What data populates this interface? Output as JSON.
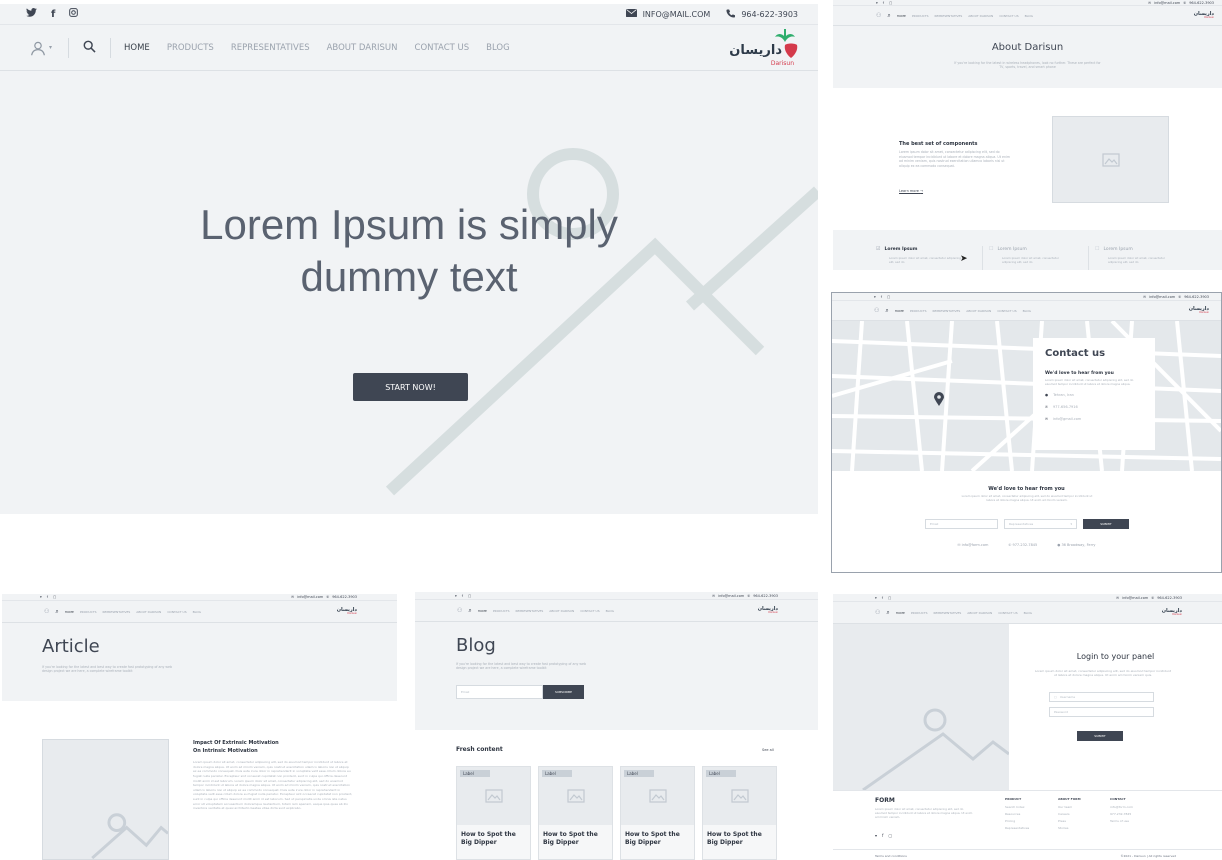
{
  "common": {
    "email": "INFO@MAIL.COM",
    "email_small": "info@mail.com",
    "phone": "964-622-3903",
    "nav": [
      "HOME",
      "PRODUCTS",
      "REPRESENTATIVES",
      "ABOUT DARISUN",
      "CONTACT US",
      "BLOG"
    ],
    "logo_fa": "داریسان",
    "logo_en": "Darisun"
  },
  "home": {
    "hero_title_line1": "Lorem Ipsum is simply",
    "hero_title_line2": "dummy text",
    "cta": "START NOW!"
  },
  "about": {
    "title": "About Darisun",
    "subtitle": "If you're looking for the latest in wireless headphones, look no further. These are perfect for TV, sports, travel, and smart phone",
    "section_title": "The best set of components",
    "section_text": "Lorem ipsum dolor sit amet, consectetur adipiscing elit, sed do eiusmod tempor incididunt ut labore et dolore magna aliqua. Ut enim ad minim veniam, quis nostrud exercitation ullamco laboris nisi ut aliquip ex ea commodo consequat.",
    "learn_more": "Learn more",
    "features": [
      {
        "title": "Lorem Ipsum",
        "text": "Lorem ipsum dolor sit amet, consectetur adipiscing elit, sed do"
      },
      {
        "title": "Lorem Ipsum",
        "text": "Lorem ipsum dolor sit amet, consectetur adipiscing elit, sed do"
      },
      {
        "title": "Lorem Ipsum",
        "text": "Lorem ipsum dolor sit amet, consectetur adipiscing elit, sed do"
      }
    ]
  },
  "contact": {
    "card_title": "Contact us",
    "card_subtitle": "We'd love to hear from you",
    "card_text": "Lorem ipsum dolor sit amet, consectetur adipiscing elit, sed do eiusmod tempor incididunt ut labore et dolore magna aliqua.",
    "address": "Tehran, Iran",
    "phone": "977-656-7916",
    "email": "info@gmail.com",
    "form_title": "We'd love to hear from you",
    "form_text": "Lorem ipsum dolor sit amet, consectetur adipiscing elit, sed do eiusmod tempor incididunt ut labore et dolore magna aliqua. Ut enim ad minim veniam.",
    "email_placeholder": "Email",
    "select_placeholder": "Representatives",
    "submit": "SUBMIT",
    "footer_email": "info@form.com",
    "footer_phone": "977-232-7845",
    "footer_address": "36 Broadway, Ferry"
  },
  "article": {
    "title": "Article",
    "subtitle": "If you're looking for the latest and best way to create fast prototyping of any web design project we are here, a complete wireframe toolkit",
    "heading_line1": "Impact Of Extrinsic Motivation",
    "heading_line2": "On Intrinsic Motivation",
    "body": "Lorem ipsum dolor sit amet, consectetur adipiscing elit, sed do eiusmod tempor incididunt ut labore et dolore magna aliqua. Ut enim ad minim veniam, quis nostrud exercitation ullamco laboris nisi ut aliquip ex ea commodo consequat. Duis aute irure dolor in reprehenderit in voluptate velit esse cillum dolore eu fugiat nulla pariatur. Excepteur sint occaecat cupidatat non proident, sunt in culpa qui officia deserunt mollit anim id est laborum. Lorem ipsum dolor sit amet, consectetur adipiscing elit, sed do eiusmod tempor incididunt ut labore et dolore magna aliqua. Ut enim ad minim veniam, quis nostrud exercitation ullamco laboris nisi ut aliquip ex ea commodo consequat. Duis aute irure dolor in reprehenderit in voluptate velit esse cillum dolore eu fugiat nulla pariatur. Excepteur sint occaecat cupidatat non proident, sunt in culpa qui officia deserunt mollit anim id est laborum. Sed ut perspiciatis unde omnis iste natus error sit voluptatem accusantium doloremque laudantium, totam rem aperiam, eaque ipsa quae ab illo inventore veritatis et quasi architecto beatae vitae dicta sunt explicabo."
  },
  "blog": {
    "title": "Blog",
    "subtitle": "If you're looking for the latest and best way to create fast prototyping of any web design project we are here, a complete wireframe toolkit",
    "email_placeholder": "Email",
    "subscribe": "SUBSCRIBE",
    "fresh": "Fresh content",
    "see_all": "See all",
    "cards": [
      {
        "tag": "Label",
        "title": "How to Spot the Big Dipper"
      },
      {
        "tag": "Label",
        "title": "How to Spot the Big Dipper"
      },
      {
        "tag": "Label",
        "title": "How to Spot the Big Dipper"
      },
      {
        "tag": "Label",
        "title": "How to Spot the Big Dipper"
      }
    ]
  },
  "login": {
    "title": "Login to your panel",
    "text": "Lorem ipsum dolor sit amet, consectetur adipiscing elit, sed do eiusmod tempor incididunt ut labore et dolore magna aliqua. Ut enim ad minim veniam quis.",
    "username_placeholder": "Username",
    "password_placeholder": "Password",
    "submit": "SUBMIT",
    "footer": {
      "form_title": "FORM",
      "form_text": "Lorem ipsum dolor sit amet, consectetur adipiscing elit, sed do eiusmod tempor incididunt ut labore et dolore magna aliqua. Ut enim ad minim veniam.",
      "columns": [
        {
          "title": "PRODUCT",
          "items": [
            "Search Index",
            "Resources",
            "Pricing",
            "Representatives"
          ]
        },
        {
          "title": "ABOUT FORM",
          "items": [
            "Our team",
            "Careers",
            "Press",
            "Stories"
          ]
        },
        {
          "title": "CONTACT",
          "items": [
            "info@form.com",
            "977-232-7845",
            "Terms of use"
          ]
        }
      ],
      "terms": "Terms and conditions",
      "copyright": "©2021 - Darisun | All rights reserved"
    }
  }
}
